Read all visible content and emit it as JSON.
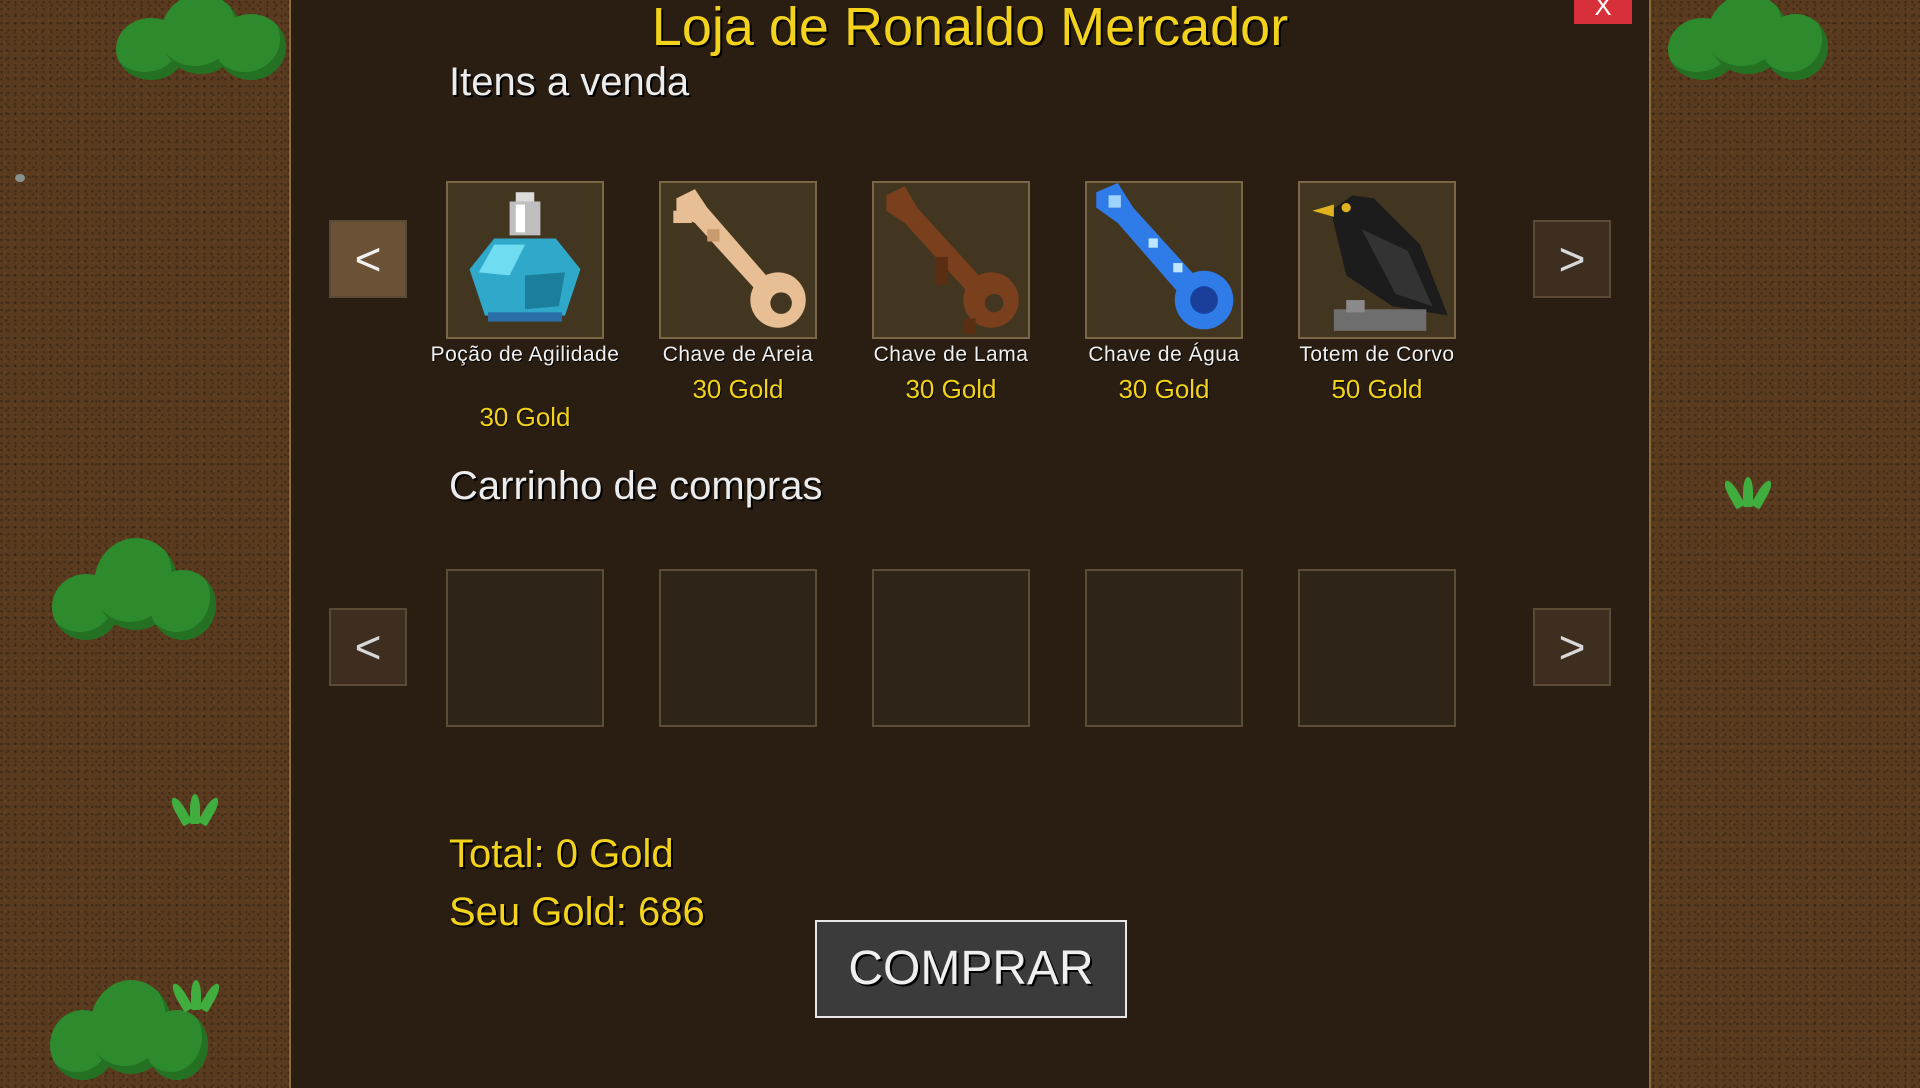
{
  "shop": {
    "title": "Loja de Ronaldo Mercador",
    "close_label": "X",
    "for_sale_heading": "Itens a venda",
    "cart_heading": "Carrinho de compras",
    "prev_arrow": "<",
    "next_arrow": ">",
    "items": [
      {
        "name": "Poção de Agilidade",
        "price": "30 Gold",
        "icon": "agility-potion-icon"
      },
      {
        "name": "Chave de Areia",
        "price": "30 Gold",
        "icon": "sand-key-icon"
      },
      {
        "name": "Chave de Lama",
        "price": "30 Gold",
        "icon": "mud-key-icon"
      },
      {
        "name": "Chave de Água",
        "price": "30 Gold",
        "icon": "water-key-icon"
      },
      {
        "name": "Totem de Corvo",
        "price": "50 Gold",
        "icon": "crow-totem-icon"
      }
    ],
    "total_label": "Total: 0 Gold",
    "player_gold_label": "Seu Gold: 686",
    "buy_button": "COMPRAR"
  },
  "colors": {
    "accent_gold": "#f2d21a",
    "panel_bg": "#2a1d11",
    "close_red": "#d8303a"
  }
}
